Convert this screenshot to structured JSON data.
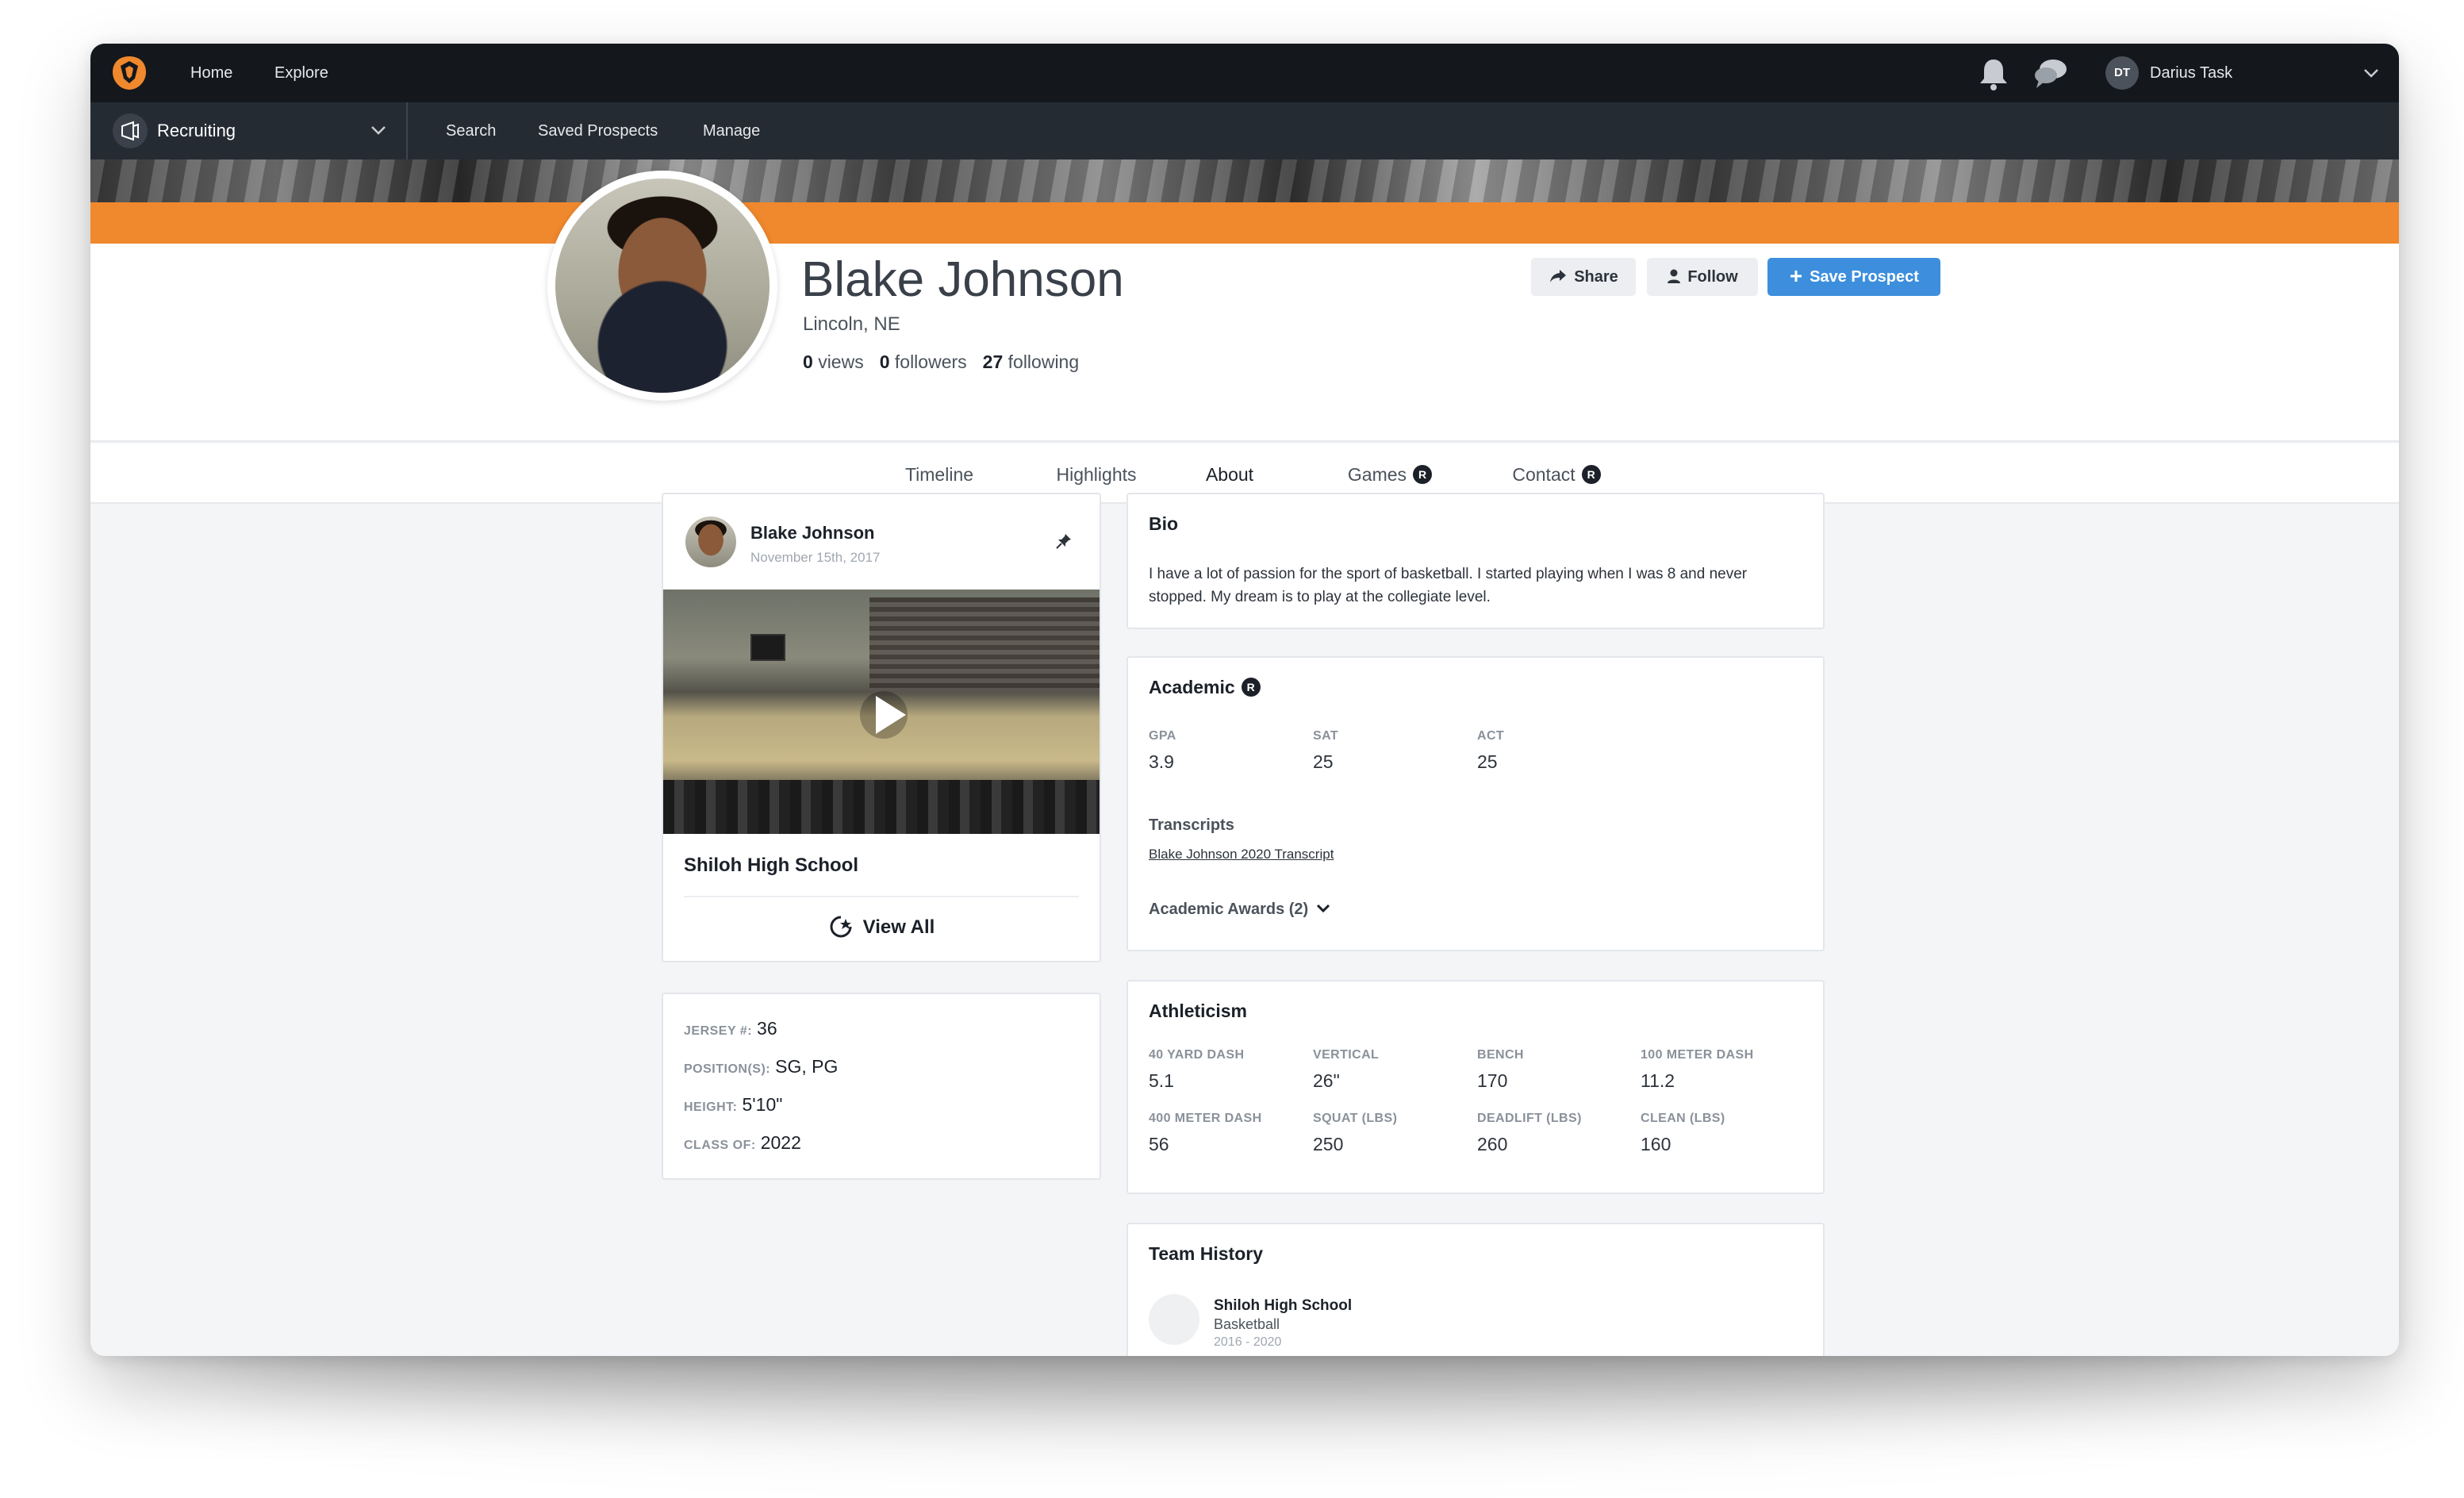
{
  "nav": {
    "home": "Home",
    "explore": "Explore",
    "user_initials": "DT",
    "user_name": "Darius Task"
  },
  "subnav": {
    "selector": "Recruiting",
    "search": "Search",
    "saved_prospects": "Saved Prospects",
    "manage": "Manage"
  },
  "profile": {
    "name": "Blake Johnson",
    "location": "Lincoln, NE",
    "views_count": "0",
    "views_label": "views",
    "followers_count": "0",
    "followers_label": "followers",
    "following_count": "27",
    "following_label": "following",
    "share": "Share",
    "follow": "Follow",
    "save_prospect": "Save Prospect"
  },
  "tabs": {
    "timeline": "Timeline",
    "highlights": "Highlights",
    "about": "About",
    "games": "Games",
    "contact": "Contact",
    "badge": "R"
  },
  "post": {
    "author": "Blake Johnson",
    "date": "November 15th, 2017",
    "school": "Shiloh High School",
    "view_all": "View All"
  },
  "info": {
    "jersey_label": "JERSEY #:",
    "jersey": "36",
    "positions_label": "POSITION(S):",
    "positions": "SG, PG",
    "height_label": "HEIGHT:",
    "height": "5'10\"",
    "class_label": "CLASS OF:",
    "class_of": "2022"
  },
  "bio": {
    "title": "Bio",
    "text": "I have a lot of passion for the sport of basketball. I started playing when I was 8 and never stopped. My dream is to play at the collegiate level."
  },
  "academic": {
    "title": "Academic",
    "badge": "R",
    "gpa_label": "GPA",
    "gpa": "3.9",
    "sat_label": "SAT",
    "sat": "25",
    "act_label": "ACT",
    "act": "25",
    "transcripts_label": "Transcripts",
    "transcript_link": "Blake Johnson 2020 Transcript",
    "awards": "Academic Awards (2)"
  },
  "athleticism": {
    "title": "Athleticism",
    "items": [
      {
        "label": "40 YARD DASH",
        "value": "5.1"
      },
      {
        "label": "VERTICAL",
        "value": "26\""
      },
      {
        "label": "BENCH",
        "value": "170"
      },
      {
        "label": "100 METER DASH",
        "value": "11.2"
      },
      {
        "label": "400 METER DASH",
        "value": "56"
      },
      {
        "label": "SQUAT (LBS)",
        "value": "250"
      },
      {
        "label": "DEADLIFT (LBS)",
        "value": "260"
      },
      {
        "label": "CLEAN (LBS)",
        "value": "160"
      }
    ]
  },
  "team_history": {
    "title": "Team History",
    "team": "Shiloh High School",
    "sport": "Basketball",
    "years": "2016 - 2020"
  },
  "colors": {
    "accent_orange": "#f0882d",
    "primary_blue": "#3d8fdd",
    "nav_dark": "#14181d"
  },
  "icons": [
    "logo-icon",
    "bell-icon",
    "chat-icon",
    "chevron-down-icon",
    "megaphone-icon",
    "share-icon",
    "follow-icon",
    "plus-icon",
    "pin-icon",
    "play-icon",
    "view-all-icon"
  ]
}
